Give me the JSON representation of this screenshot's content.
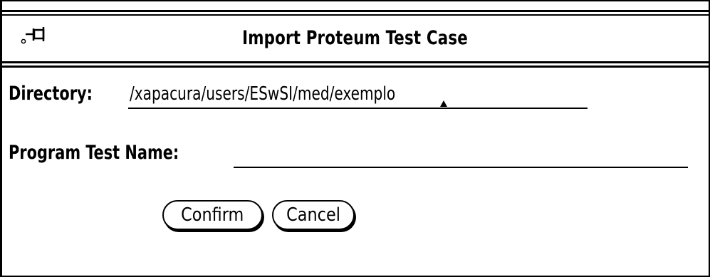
{
  "dialog": {
    "title": "Import Proteum Test Case",
    "pin_icon": "pushpin-icon"
  },
  "fields": {
    "directory": {
      "label": "Directory:",
      "value": "/xapacura/users/ESwSI/med/exemplo"
    },
    "program_test_name": {
      "label": "Program Test Name:",
      "value": ""
    }
  },
  "buttons": {
    "confirm_label": "Confirm",
    "cancel_label": "Cancel"
  }
}
